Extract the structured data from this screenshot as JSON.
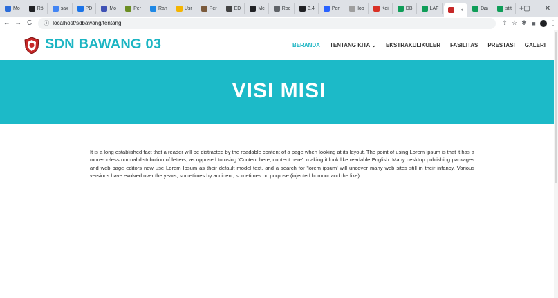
{
  "browser": {
    "tabs": [
      {
        "label": "Mo",
        "color": "#2b6cd9"
      },
      {
        "label": "Rö",
        "color": "#202124"
      },
      {
        "label": "sax",
        "color": "#4285f4"
      },
      {
        "label": "PD",
        "color": "#1a73e8"
      },
      {
        "label": "Mo",
        "color": "#3f51b5"
      },
      {
        "label": "Per",
        "color": "#6b8e23"
      },
      {
        "label": "Ran",
        "color": "#1e88e5"
      },
      {
        "label": "Usr",
        "color": "#f4b400"
      },
      {
        "label": "Per",
        "color": "#7b5a3c"
      },
      {
        "label": "ED",
        "color": "#424242"
      },
      {
        "label": "Mc",
        "color": "#202124"
      },
      {
        "label": "Roc",
        "color": "#5f6368"
      },
      {
        "label": "3.4",
        "color": "#202124"
      },
      {
        "label": "Pen",
        "color": "#2962ff"
      },
      {
        "label": "loo",
        "color": "#9e9e9e"
      },
      {
        "label": "Kei",
        "color": "#d93025"
      },
      {
        "label": "DB",
        "color": "#0f9d58"
      },
      {
        "label": "LAF",
        "color": "#0f9d58"
      }
    ],
    "active_tab": {
      "label": "",
      "close": "×"
    },
    "trailing_tabs": [
      {
        "label": "Dm",
        "color": "#0f9d58"
      },
      {
        "label": "stit",
        "color": "#0f9d58"
      }
    ],
    "new_tab": "+",
    "window_controls": {
      "dropdown": "⌄",
      "minimize": "−",
      "maximize": "▢",
      "close": "✕"
    },
    "url": "localhost/sdbawang/tentang",
    "nav": {
      "back": "←",
      "forward": "→",
      "reload": "C"
    }
  },
  "site": {
    "title": "SDN BAWANG 03",
    "menu": [
      {
        "label": "BERANDA",
        "active": true
      },
      {
        "label": "TENTANG KITA ⌄",
        "active": false
      },
      {
        "label": "EKSTRAKULIKULER",
        "active": false
      },
      {
        "label": "FASILITAS",
        "active": false
      },
      {
        "label": "PRESTASI",
        "active": false
      },
      {
        "label": "GALERI",
        "active": false
      }
    ]
  },
  "hero": {
    "title": "VISI MISI"
  },
  "content": {
    "paragraph": "It is a long established fact that a reader will be distracted by the readable content of a page when looking at its layout. The point of using Lorem Ipsum is that it has a more-or-less normal distribution of letters, as opposed to using 'Content here, content here', making it look like readable English. Many desktop publishing packages and web page editors now use Lorem Ipsum as their default model text, and a search for 'lorem ipsum' will uncover many web sites still in their infancy. Various versions have evolved over the years, sometimes by accident, sometimes on purpose (injected humour and the like)."
  }
}
